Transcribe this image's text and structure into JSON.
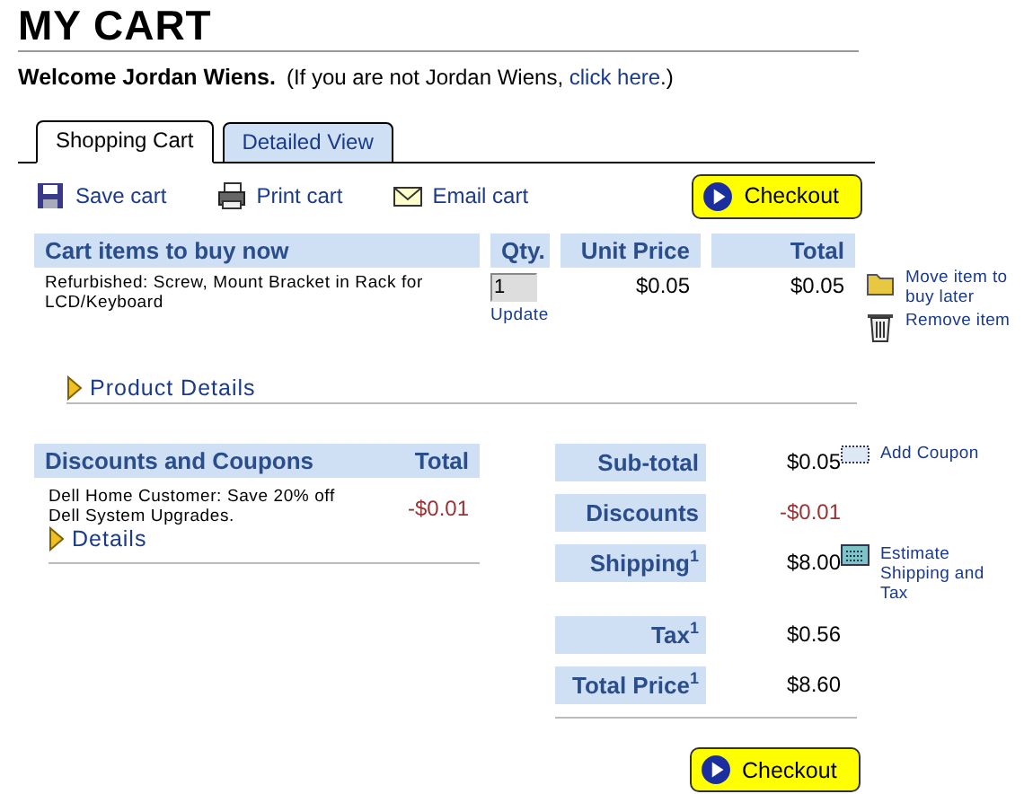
{
  "title": "MY CART",
  "welcome": {
    "greeting": "Welcome Jordan Wiens.",
    "note_before": "(If you are not Jordan Wiens, ",
    "link": "click here",
    "note_after": ".)"
  },
  "tabs": [
    {
      "label": "Shopping Cart",
      "selected": true
    },
    {
      "label": "Detailed View",
      "selected": false
    }
  ],
  "toolbar": [
    {
      "label": "Save cart",
      "kind": "save"
    },
    {
      "label": "Print cart",
      "kind": "print"
    },
    {
      "label": "Email cart",
      "kind": "email"
    }
  ],
  "checkout_top": "Checkout",
  "cart": {
    "columns": [
      "Cart items to buy now",
      "Qty.",
      "Unit Price",
      "Total"
    ],
    "items": [
      {
        "description": "Refurbished: Screw, Mount Bracket in Rack for LCD/Keyboard",
        "qty": "1",
        "update": "Update",
        "unit_price": "$0.05",
        "total": "$0.05",
        "actions": [
          {
            "label": "Move item to buy later",
            "kind": "folder"
          },
          {
            "label": "Remove item",
            "kind": "trash"
          }
        ]
      }
    ],
    "details_link": "Product Details"
  },
  "discounts": {
    "columns": [
      "Discounts and Coupons",
      "Total"
    ],
    "items": [
      {
        "description": "Dell Home Customer: Save 20% off Dell System Upgrades.",
        "amount": "-$0.01",
        "details_link": "Details"
      }
    ]
  },
  "summary": [
    {
      "label": "Sub-total",
      "value": "$0.05",
      "negative": false,
      "action": {
        "label": "Add Coupon",
        "kind": "coupon"
      }
    },
    {
      "label": "Discounts",
      "value": "-$0.01",
      "negative": true
    },
    {
      "label": "Shipping$^{1}$",
      "value": "$8.00",
      "negative": false,
      "action": {
        "label": "Estimate Shipping and Tax",
        "kind": "calculator"
      }
    },
    {
      "label": "Tax$^{1}$",
      "value": "$0.56",
      "negative": false
    },
    {
      "label": "Total Price$^{1}$",
      "value": "$8.60",
      "negative": false
    }
  ],
  "checkout_bottom": "Checkout"
}
